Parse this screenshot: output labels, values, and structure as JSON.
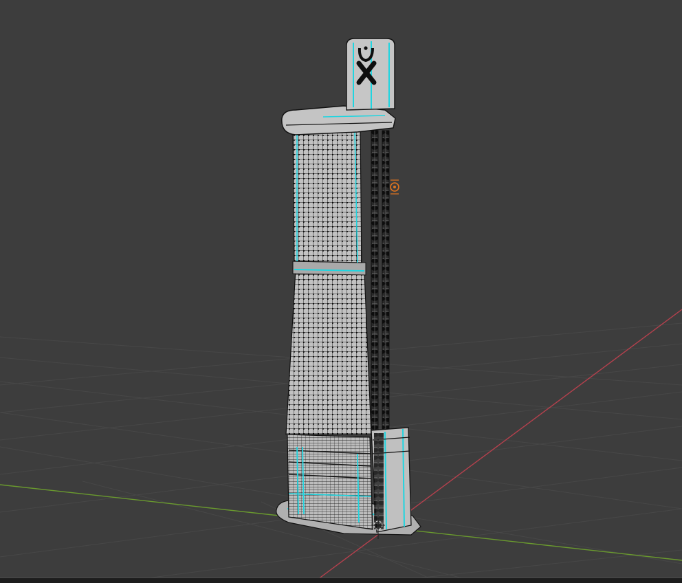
{
  "viewport": {
    "background": "#3d3d3d",
    "grid_color": "#474747",
    "x_axis_color": "#b5404d",
    "y_axis_color": "#6a9a2e"
  },
  "scene": {
    "object_fill": "#b9b9b9",
    "object_shade": "#8f8f8f",
    "wire_color": "#141414",
    "vertex_color": "#0a0a0a",
    "seam_color": "#1fd5e0",
    "origin_color": "#e0741f",
    "icons": [
      "3d-cursor-icon",
      "object-origin-icon"
    ]
  }
}
